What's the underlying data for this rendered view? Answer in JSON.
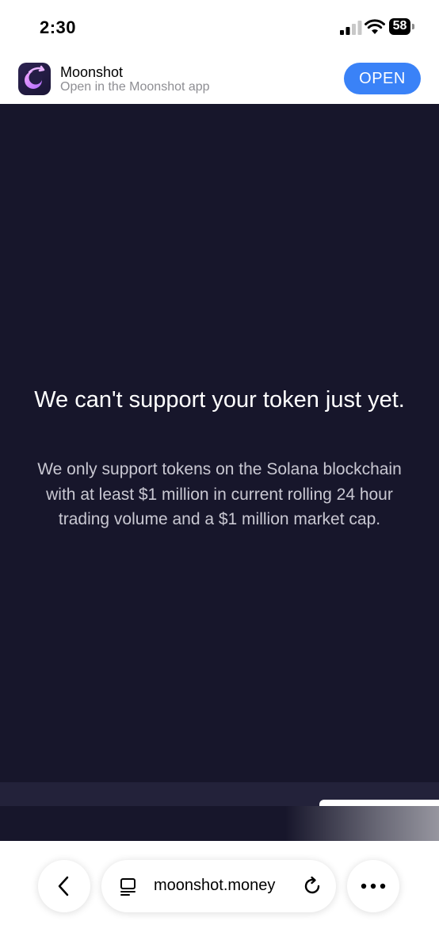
{
  "status_bar": {
    "time": "2:30",
    "battery_level": "58"
  },
  "app_banner": {
    "app_name": "Moonshot",
    "subtitle": "Open in the Moonshot app",
    "open_label": "OPEN",
    "accent_color": "#3a82f7"
  },
  "main": {
    "heading": "We can't support your token just yet.",
    "description": "We only support tokens on the Solana blockchain with at least $1 million in current rolling 24 hour trading volume and a $1 million market cap.",
    "background_color": "#17162b"
  },
  "browser_bar": {
    "url": "moonshot.money",
    "icons": [
      "back-chevron-icon",
      "reader-mode-icon",
      "reload-icon",
      "more-dots-icon"
    ]
  }
}
